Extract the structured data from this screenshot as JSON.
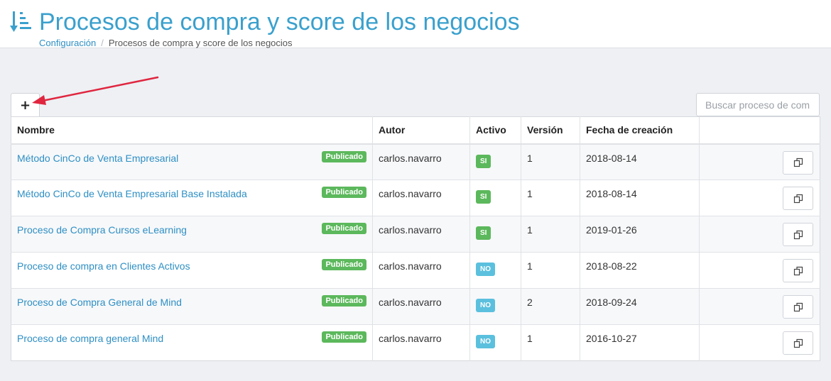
{
  "header": {
    "title": "Procesos de compra y score de los negocios",
    "icon": "sort-list-icon",
    "accent_color": "#3aa0cd"
  },
  "breadcrumb": {
    "parent": "Configuración",
    "separator": "/",
    "current": "Procesos de compra y score de los negocios"
  },
  "toolbar": {
    "add_label": "+",
    "search_placeholder": "Buscar proceso de compra"
  },
  "table": {
    "columns": [
      "Nombre",
      "Autor",
      "Activo",
      "Versión",
      "Fecha de creación",
      ""
    ],
    "rows": [
      {
        "name": "Método CinCo de Venta Empresarial",
        "status": "Publicado",
        "author": "carlos.navarro",
        "active": "SI",
        "version": "1",
        "date": "2018-08-14"
      },
      {
        "name": "Método CinCo de Venta Empresarial Base Instalada",
        "status": "Publicado",
        "author": "carlos.navarro",
        "active": "SI",
        "version": "1",
        "date": "2018-08-14"
      },
      {
        "name": "Proceso de Compra Cursos eLearning",
        "status": "Publicado",
        "author": "carlos.navarro",
        "active": "SI",
        "version": "1",
        "date": "2019-01-26"
      },
      {
        "name": "Proceso de compra en Clientes Activos",
        "status": "Publicado",
        "author": "carlos.navarro",
        "active": "NO",
        "version": "1",
        "date": "2018-08-22"
      },
      {
        "name": "Proceso de Compra General de Mind",
        "status": "Publicado",
        "author": "carlos.navarro",
        "active": "NO",
        "version": "2",
        "date": "2018-09-24"
      },
      {
        "name": "Proceso de compra general Mind",
        "status": "Publicado",
        "author": "carlos.navarro",
        "active": "NO",
        "version": "1",
        "date": "2016-10-27"
      }
    ]
  },
  "colors": {
    "published": "#5cb85c",
    "active_yes": "#5cb85c",
    "active_no": "#5bc0de",
    "link": "#2e8fc4",
    "annotation_arrow": "#e0263f"
  }
}
